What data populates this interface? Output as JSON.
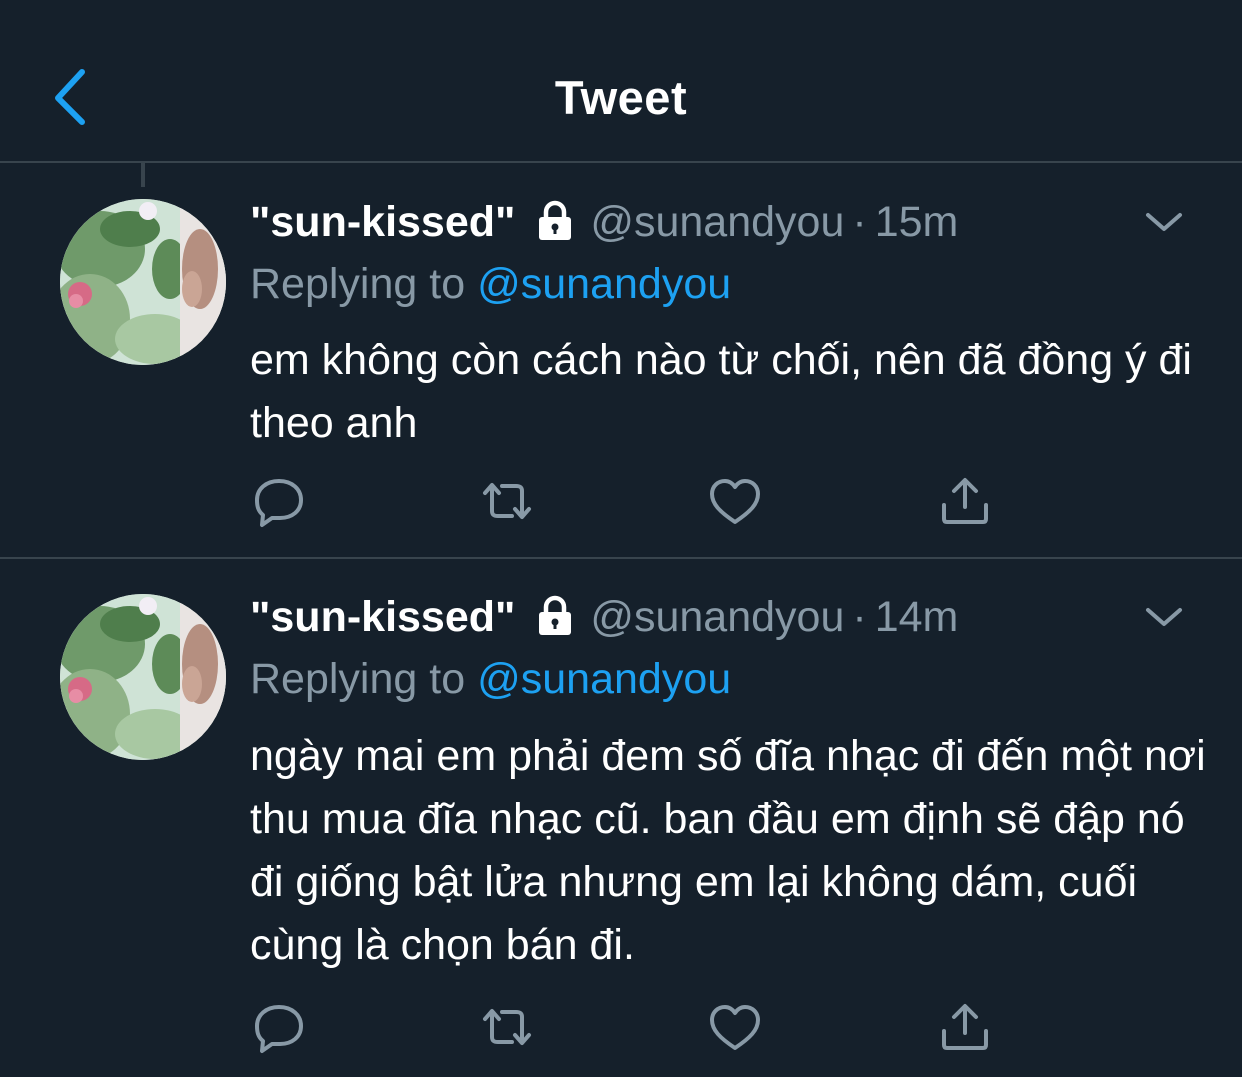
{
  "header": {
    "title": "Tweet",
    "back_icon": "chevron-left-icon",
    "accent_color": "#1da1f2",
    "background_color": "#15202b"
  },
  "tweets": [
    {
      "display_name": "\"sun-kissed\"",
      "protected_icon": "lock-icon",
      "handle": "@sunandyou",
      "separator": "·",
      "time": "15m",
      "replying_prefix": "Replying to",
      "replying_handle": "@sunandyou",
      "text": "em không còn cách nào từ chối, nên đã đồng ý đi theo anh",
      "actions": [
        "reply-icon",
        "retweet-icon",
        "like-icon",
        "share-icon"
      ]
    },
    {
      "display_name": "\"sun-kissed\"",
      "protected_icon": "lock-icon",
      "handle": "@sunandyou",
      "separator": "·",
      "time": "14m",
      "replying_prefix": "Replying to",
      "replying_handle": "@sunandyou",
      "text": "ngày mai em phải đem số đĩa nhạc đi đến một nơi thu mua đĩa nhạc cũ. ban đầu em định sẽ đập nó đi giống bật lửa nhưng em lại không dám, cuối cùng là chọn bán đi.",
      "actions": [
        "reply-icon",
        "retweet-icon",
        "like-icon",
        "share-icon"
      ]
    }
  ]
}
